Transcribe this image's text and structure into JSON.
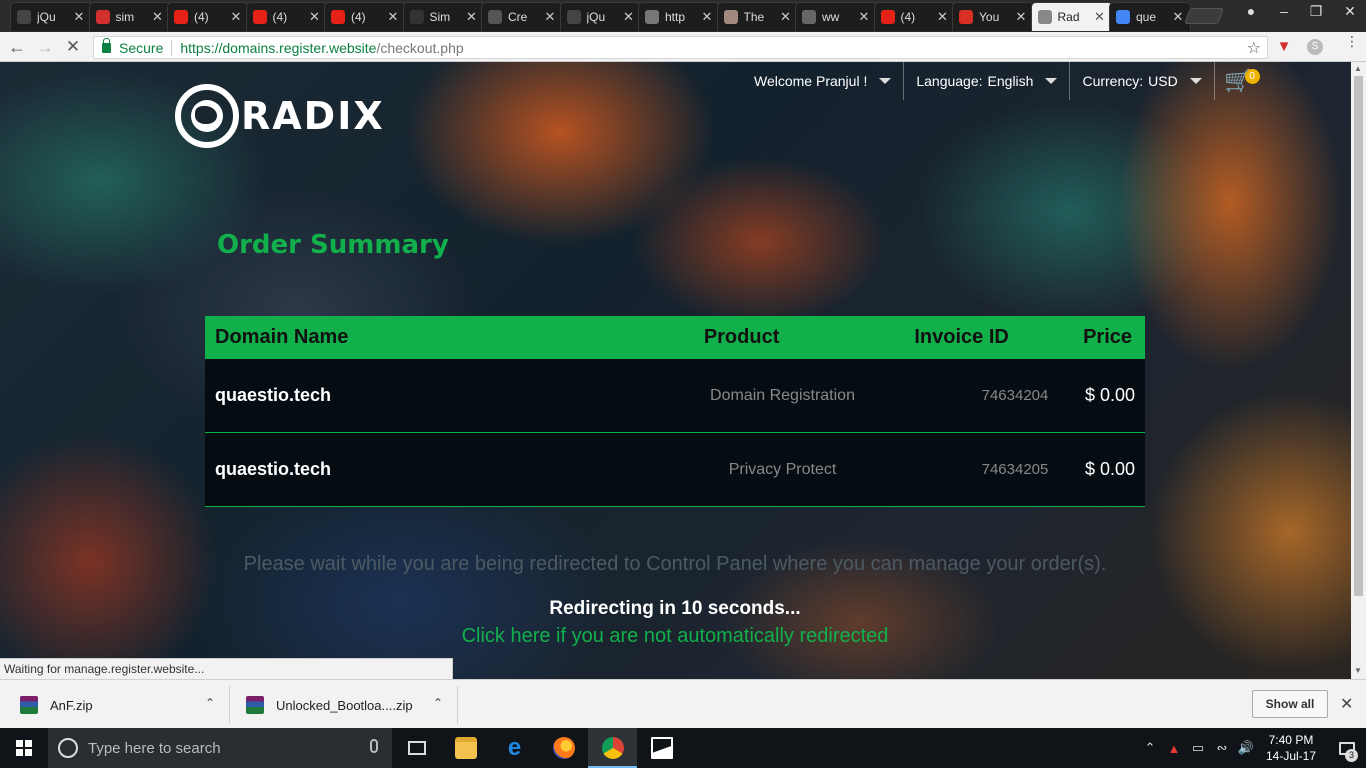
{
  "browser": {
    "tabs": [
      {
        "label": "jQu",
        "icon": "codepen-icon",
        "color": "#444444"
      },
      {
        "label": "sim",
        "icon": "n-icon",
        "color": "#d32f2f"
      },
      {
        "label": "(4)",
        "icon": "youtube-icon",
        "color": "#e62117"
      },
      {
        "label": "(4)",
        "icon": "youtube-icon",
        "color": "#e62117"
      },
      {
        "label": "(4)",
        "icon": "youtube-icon",
        "color": "#e62117"
      },
      {
        "label": "Sim",
        "icon": "github-icon",
        "color": "#333333"
      },
      {
        "label": "Cre",
        "icon": "gear-icon",
        "color": "#555555"
      },
      {
        "label": "jQu",
        "icon": "codepen-icon",
        "color": "#444444"
      },
      {
        "label": "http",
        "icon": "page-icon",
        "color": "#777777"
      },
      {
        "label": "The",
        "icon": "image-icon",
        "color": "#a1887f"
      },
      {
        "label": "ww",
        "icon": "fm-icon",
        "color": "#666666"
      },
      {
        "label": "(4)",
        "icon": "youtube-icon",
        "color": "#e62117"
      },
      {
        "label": "You",
        "icon": "gmail-icon",
        "color": "#d93025"
      },
      {
        "label": "Rad",
        "icon": "blank-icon",
        "color": "#888888"
      },
      {
        "label": "que",
        "icon": "google-icon",
        "color": "#4285f4"
      }
    ],
    "active_tab_index": 13,
    "secure_label": "Secure",
    "url_host": "https://domains.register.website",
    "url_path": "/checkout.php",
    "status_text": "Waiting for manage.register.website..."
  },
  "site": {
    "logo_text": "RADIX",
    "welcome": "Welcome Pranjul !",
    "language_label": "Language:",
    "language_value": "English",
    "currency_label": "Currency:",
    "currency_value": "USD",
    "cart_count": "0",
    "accent_color": "#12b04a"
  },
  "order": {
    "title": "Order Summary",
    "headers": {
      "domain": "Domain Name",
      "product": "Product",
      "invoice": "Invoice ID",
      "price": "Price"
    },
    "rows": [
      {
        "domain": "quaestio.tech",
        "product": "Domain Registration",
        "invoice": "74634204",
        "price": "$ 0.00"
      },
      {
        "domain": "quaestio.tech",
        "product": "Privacy Protect",
        "invoice": "74634205",
        "price": "$ 0.00"
      }
    ],
    "wait_message": "Please wait while you are being redirected to Control Panel where you can manage your order(s).",
    "redirect_message": "Redirecting in 10 seconds...",
    "click_here": "Click here if you are not automatically redirected"
  },
  "downloads": {
    "items": [
      {
        "name": "AnF.zip"
      },
      {
        "name": "Unlocked_Bootloa....zip"
      }
    ],
    "show_all": "Show all"
  },
  "taskbar": {
    "search_placeholder": "Type here to search",
    "time": "7:40 PM",
    "date": "14-Jul-17",
    "notifications": "3"
  }
}
